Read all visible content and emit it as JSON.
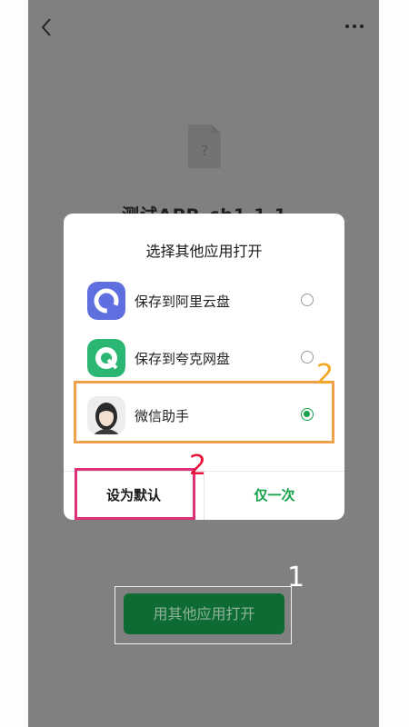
{
  "nav": {
    "back_icon": "chevron-left-icon",
    "more_icon": "more-horizontal-icon"
  },
  "file": {
    "icon": "unknown-file-icon",
    "name": "测试APP_ch1.1.1"
  },
  "dialog": {
    "title": "选择其他应用打开",
    "options": [
      {
        "label": "保存到阿里云盘",
        "icon": "aliyun-drive-icon",
        "selected": false
      },
      {
        "label": "保存到夸克网盘",
        "icon": "quark-drive-icon",
        "selected": false
      },
      {
        "label": "微信助手",
        "icon": "wechat-assistant-avatar-icon",
        "selected": true
      }
    ],
    "buttons": {
      "set_default": "设为默认",
      "once": "仅一次"
    }
  },
  "open_button_label": "用其他应用打开",
  "annotations": {
    "one": "1",
    "two_a": "2",
    "two_b": "2"
  },
  "colors": {
    "accent_green": "#13a049",
    "orange": "#f0a04b",
    "pink": "#e0307a"
  }
}
